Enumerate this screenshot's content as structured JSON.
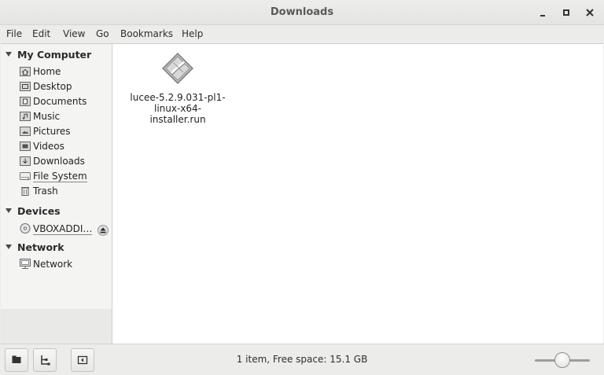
{
  "window": {
    "title": "Downloads"
  },
  "window_controls": {
    "minimize": "▪",
    "maximize": "▫",
    "close": "✕"
  },
  "menubar": [
    "File",
    "Edit",
    "View",
    "Go",
    "Bookmarks",
    "Help"
  ],
  "sidebar": {
    "sections": [
      {
        "title": "My Computer",
        "items": [
          {
            "label": "Home",
            "icon": "home-folder-icon"
          },
          {
            "label": "Desktop",
            "icon": "desktop-folder-icon"
          },
          {
            "label": "Documents",
            "icon": "documents-folder-icon"
          },
          {
            "label": "Music",
            "icon": "music-folder-icon"
          },
          {
            "label": "Pictures",
            "icon": "pictures-folder-icon"
          },
          {
            "label": "Videos",
            "icon": "videos-folder-icon"
          },
          {
            "label": "Downloads",
            "icon": "downloads-folder-icon"
          },
          {
            "label": "File System",
            "icon": "drive-icon"
          },
          {
            "label": "Trash",
            "icon": "trash-icon"
          }
        ]
      },
      {
        "title": "Devices",
        "items": [
          {
            "label": "VBOXADDI…",
            "icon": "optical-disc-icon"
          }
        ]
      },
      {
        "title": "Network",
        "items": [
          {
            "label": "Network",
            "icon": "network-icon"
          }
        ]
      }
    ]
  },
  "content": {
    "files": [
      {
        "name_line1": "lucee-5.2.9.031-pl1-",
        "name_line2": "linux-x64-installer.run",
        "icon": "executable-file-icon"
      }
    ]
  },
  "statusbar": {
    "text": "1 item, Free space: 15.1 GB",
    "zoom_level": 0.45
  },
  "colors": {
    "content_bg": "#ffffff",
    "sidebar_bg": "#f4f4f3",
    "chrome_bg": "#ececeb"
  }
}
